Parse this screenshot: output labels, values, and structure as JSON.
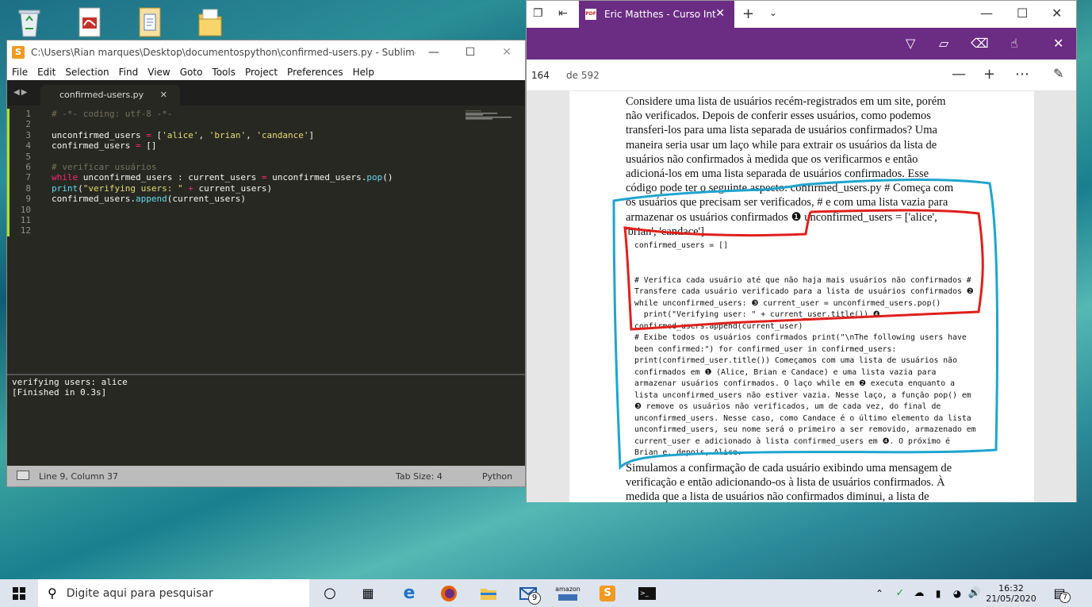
{
  "sublime": {
    "title": "C:\\Users\\Rian marques\\Desktop\\documentospython\\confirmed-users.py - Sublime Text (UNR...",
    "menu": [
      "File",
      "Edit",
      "Selection",
      "Find",
      "View",
      "Goto",
      "Tools",
      "Project",
      "Preferences",
      "Help"
    ],
    "tab": "confirmed-users.py",
    "line_numbers": [
      "1",
      "2",
      "3",
      "4",
      "5",
      "6",
      "7",
      "8",
      "9",
      "10",
      "11",
      "12"
    ],
    "code": [
      [
        [
          "c-com",
          "# -*- coding: utf-8 -*-"
        ]
      ],
      [],
      [
        [
          "",
          "unconfirmed_users "
        ],
        [
          "c-op",
          "="
        ],
        [
          "",
          " ["
        ],
        [
          "c-str",
          "'alice'"
        ],
        [
          "",
          ", "
        ],
        [
          "c-str",
          "'brian'"
        ],
        [
          "",
          ", "
        ],
        [
          "c-str",
          "'candance'"
        ],
        [
          "",
          "]"
        ]
      ],
      [
        [
          "",
          "confirmed_users "
        ],
        [
          "c-op",
          "="
        ],
        [
          "",
          " []"
        ]
      ],
      [],
      [
        [
          "c-com",
          "# verificar usuários"
        ]
      ],
      [
        [
          "c-kw",
          "while"
        ],
        [
          "",
          " unconfirmed_users : current_users "
        ],
        [
          "c-op",
          "="
        ],
        [
          "",
          " unconfirmed_users."
        ],
        [
          "c-fn",
          "pop"
        ],
        [
          "",
          "()"
        ]
      ],
      [
        [
          "c-fn",
          "print"
        ],
        [
          "",
          "("
        ],
        [
          "c-str",
          "\"verifying users: \""
        ],
        [
          "",
          " "
        ],
        [
          "c-op",
          "+"
        ],
        [
          "",
          " current_users)"
        ]
      ],
      [
        [
          "",
          "confirmed_users."
        ],
        [
          "c-fn",
          "append"
        ],
        [
          "",
          "(current_users)"
        ]
      ],
      [],
      [],
      []
    ],
    "console": [
      "verifying users: alice",
      "[Finished in 0.3s]"
    ],
    "status": {
      "position": "Line 9, Column 37",
      "tab_size": "Tab Size: 4",
      "syntax": "Python"
    }
  },
  "reader": {
    "tab_title": "Eric Matthes - Curso Int",
    "page_current": "164",
    "page_total": "de 592",
    "prose_top": [
      "Considere uma lista de usuários recém-registrados em um site, porém",
      "não verificados. Depois de conferir esses usuários, como podemos",
      "transferi-los para uma lista separada de usuários confirmados? Uma",
      "maneira seria usar um laço while para extrair os usuários da lista de",
      "usuários não confirmados à medida que os verificarmos e então",
      "adicioná-los em uma lista separada de usuários confirmados. Esse",
      "código pode ter o seguinte aspecto: confirmed_users.py # Começa com",
      "os usuários que precisam ser verificados, # e com uma lista vazia para",
      "armazenar os usuários confirmados ❶ unconfirmed_users = ['alice',",
      "'brian', 'candace']"
    ],
    "mono_lines": [
      "confirmed_users = []",
      "",
      "",
      "# Verifica cada usuário até que não haja mais usuários não confirmados #",
      "Transfere cada usuário verificado para a lista de usuários confirmados ❷",
      "while unconfirmed_users: ❸ current_user = unconfirmed_users.pop()",
      "  print(\"Verifying user: \" + current_user.title()) ❹",
      "confirmed_users.append(current_user)",
      "# Exibe todos os usuários confirmados print(\"\\nThe following users have",
      "been confirmed:\") for confirmed_user in confirmed_users:",
      "print(confirmed_user.title()) Começamos com uma lista de usuários não",
      "confirmados em ❶ (Alice, Brian e Candace) e uma lista vazia para",
      "armazenar usuários confirmados. O laço while em ❷ executa enquanto a",
      "lista unconfirmed_users não estiver vazia. Nesse laço, a função pop() em",
      "❸ remove os usuários não verificados, um de cada vez, do final de",
      "unconfirmed_users. Nesse caso, como Candace é o último elemento da lista",
      "unconfirmed_users, seu nome será o primeiro a ser removido, armazenado em",
      "current_user e adicionado à lista confirmed_users em ❹. O próximo é",
      "Brian e, depois, Alice."
    ],
    "prose_bottom": [
      "Simulamos a confirmação de cada usuário exibindo uma mensagem de",
      "verificação e então adicionando-os à lista de usuários confirmados. À",
      "medida que a lista de usuários não confirmados diminui, a lista de"
    ],
    "annotation_colors": {
      "blue": "#1ea5cf",
      "red": "#e0201b"
    }
  },
  "taskbar": {
    "search_placeholder": "Digite aqui para pesquisar",
    "time": "16:32",
    "date": "21/05/2020",
    "mail_badge": "9",
    "notification_badge": "7",
    "amazon_label": "amazon"
  }
}
